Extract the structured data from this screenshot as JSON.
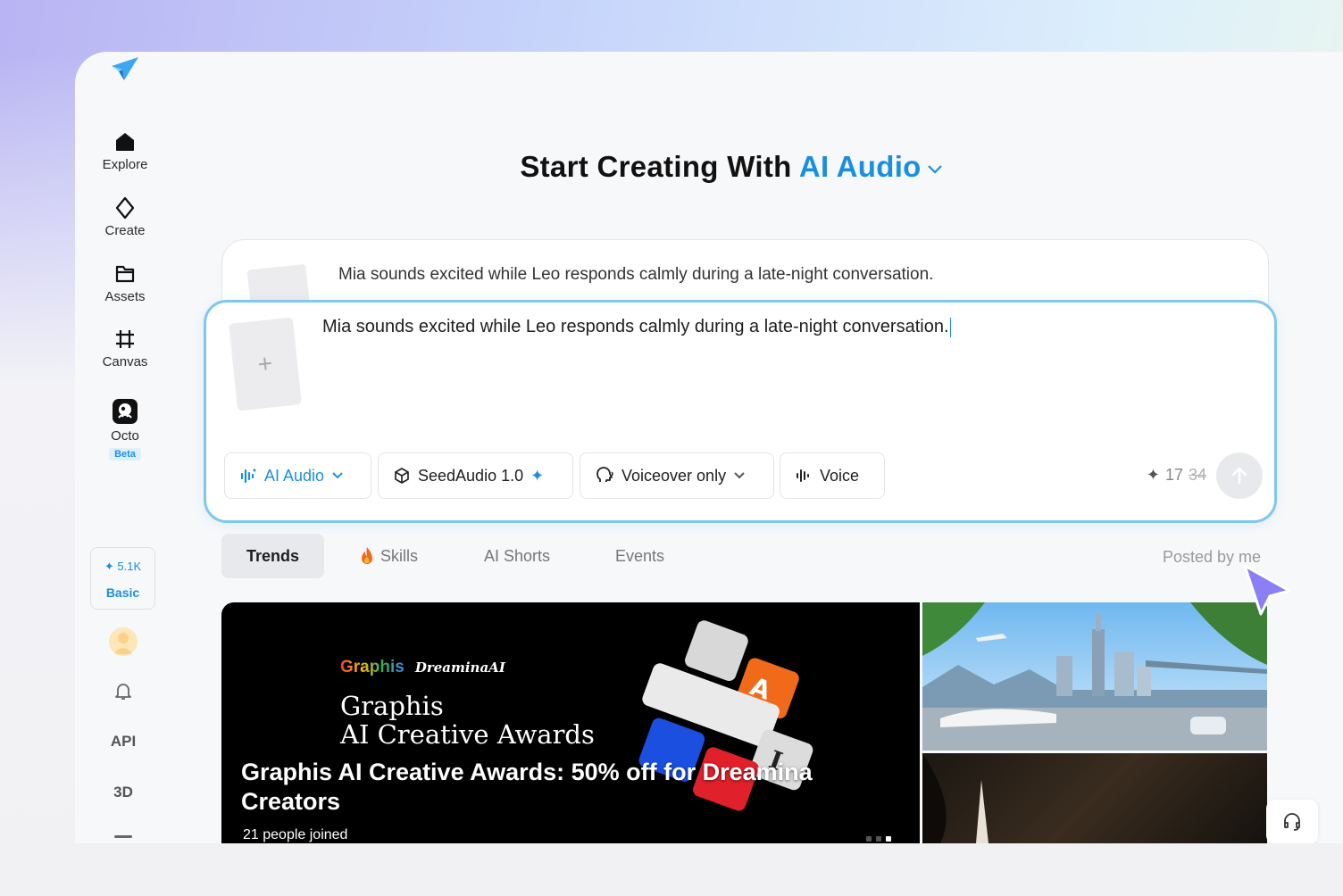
{
  "app": {
    "logo": "dreamina-star-logo"
  },
  "sidebar": {
    "items": [
      {
        "label": "Explore",
        "icon": "home-icon"
      },
      {
        "label": "Create",
        "icon": "sparkle-outline-icon"
      },
      {
        "label": "Assets",
        "icon": "folder-icon"
      },
      {
        "label": "Canvas",
        "icon": "grid-frame-icon"
      },
      {
        "label": "Octo",
        "icon": "octo-app-icon",
        "badge": "Beta"
      }
    ],
    "credits": {
      "amount": "5.1K",
      "plan": "Basic"
    },
    "api": "API",
    "three_d": "3D"
  },
  "heading": {
    "prefix": "Start Creating With",
    "accent": "AI Audio"
  },
  "prompt": {
    "previous_text": "Mia sounds excited while Leo responds calmly during a late-night conversation.",
    "text": "Mia sounds excited while Leo responds calmly during a late-night conversation.",
    "add_reference": "+"
  },
  "toolbar": {
    "mode": "AI Audio",
    "model": "SeedAudio 1.0",
    "output": "Voiceover only",
    "voice": "Voice",
    "cost": "17",
    "cost_original": "34"
  },
  "tabs": [
    {
      "label": "Trends",
      "active": true
    },
    {
      "label": "Skills",
      "icon": "fire-icon"
    },
    {
      "label": "AI Shorts"
    },
    {
      "label": "Events"
    }
  ],
  "posted_by": "Posted by me",
  "feed": {
    "hero": {
      "brand1": "Graphis",
      "brand2": "DreaminaAI",
      "poster_title_1": "Graphis",
      "poster_title_2": "AI Creative Awards",
      "headline": "Graphis AI Creative Awards: 50% off for Dreamina Creators",
      "joined": "21 people joined"
    }
  },
  "colors": {
    "accent": "#1a8fe0",
    "focus_border": "#7fc7ef"
  }
}
